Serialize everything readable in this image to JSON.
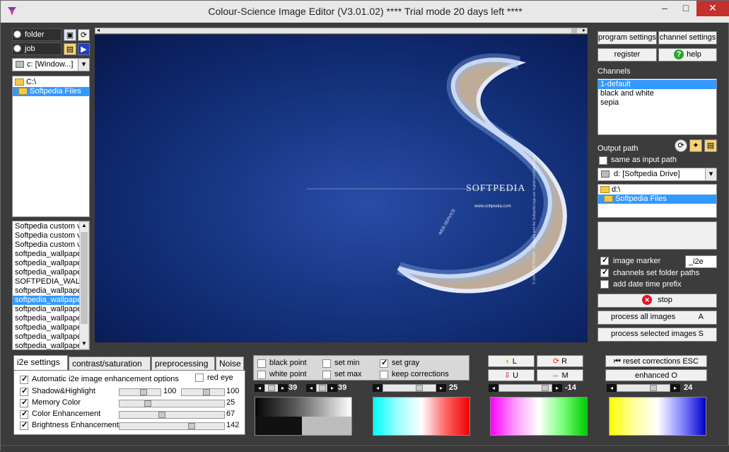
{
  "window": {
    "title": "Colour-Science Image Editor (V3.01.02)     **** Trial mode 20 days left ****",
    "minimize": "–",
    "maximize": "□",
    "close": "✕"
  },
  "left": {
    "folder_label": "folder",
    "job_label": "job",
    "drive": "c: [Window...]",
    "tree": [
      "C:\\",
      "Softpedia Files"
    ],
    "files": [
      "Softpedia custom v",
      "Softpedia custom v",
      "Softpedia custom v",
      "softpedia_wallpape",
      "softpedia_wallpape",
      "softpedia_wallpape",
      "SOFTPEDIA_WAL",
      "softpedia_wallpape",
      "softpedia_wallpape",
      "softpedia_wallpape",
      "softpedia_wallpape",
      "softpedia_wallpape",
      "softpedia_wallpape",
      "softpedia_wallpape"
    ],
    "selected_file_index": 8
  },
  "preview": {
    "watermark_main": "SOFTPEDIA",
    "watermark_url": "www.softpedia.com",
    "watermark_side": "© 2004  SOFTPEDIA  ·  Softpedia and the Softpedia logo are registered trademarks.",
    "watermark_web": "WEB  SERVICE"
  },
  "right": {
    "program_settings": "program settings",
    "channel_settings": "channel settings",
    "register": "register",
    "help": "help",
    "channels_label": "Channels",
    "channels": [
      "1-default",
      "black and white",
      "sepia"
    ],
    "selected_channel_index": 0,
    "output_path_label": "Output path",
    "same_as_input": "same as input path",
    "drive": "d: [Softpedia Drive]",
    "tree": [
      "d:\\",
      "Softpedia Files"
    ],
    "image_marker_label": "image marker",
    "image_marker_value": "_i2e",
    "channels_set_folder": "channels set folder paths",
    "add_date_prefix": "add date time prefix",
    "stop": "stop",
    "process_all": "process all images",
    "process_all_key": "A",
    "process_selected": "process selected images",
    "process_selected_key": "S"
  },
  "tabs": [
    "i2e settings",
    "contrast/saturation",
    "preprocessing",
    "Noise"
  ],
  "i2e": {
    "auto_label": "Automatic i2e image enhancement options",
    "red_eye": "red eye",
    "rows": [
      {
        "label": "Shadow&Highlight",
        "value": "100",
        "level": 0.6
      },
      {
        "label": "Memory Color",
        "value": "25",
        "level": 0.25
      },
      {
        "label": "Color Enhancement",
        "value": "67",
        "level": 0.4
      },
      {
        "label": "Brightness Enhancement",
        "value": "142",
        "level": 0.7
      }
    ],
    "shadow_value_left": "100"
  },
  "points": {
    "black_point": "black point",
    "white_point": "white point",
    "set_min": "set min",
    "set_max": "set max",
    "set_gray": "set gray",
    "keep_corrections": "keep corrections",
    "val1": "39",
    "val2": "39"
  },
  "gray_value": "25",
  "lrum": {
    "L": "L",
    "R": "R",
    "U": "U",
    "M": "M",
    "value": "-14"
  },
  "reset": {
    "reset_label": "reset corrections ESC",
    "enhanced": "enhanced  O",
    "value": "24"
  },
  "colors": {
    "accent": "#3399ff",
    "stop_red": "#e81123",
    "help_green": "#2aa52a"
  }
}
